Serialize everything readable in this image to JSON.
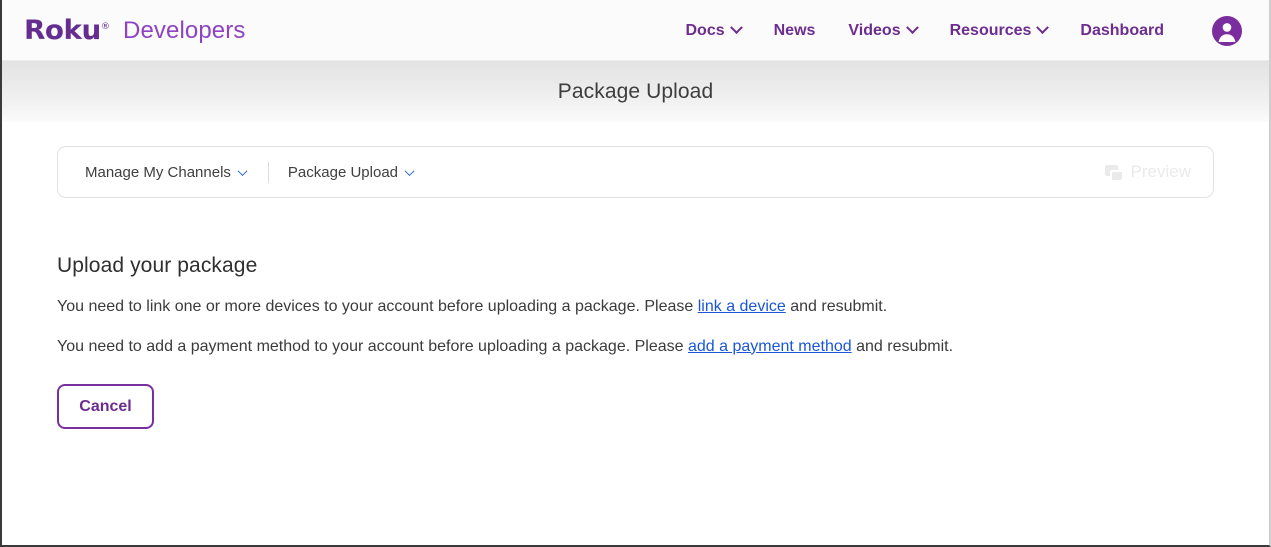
{
  "header": {
    "logo_text": "Roku",
    "logo_trademark": "®",
    "brand_sub": "Developers",
    "nav": [
      {
        "label": "Docs",
        "has_chevron": true,
        "icon": "chevron-down-icon"
      },
      {
        "label": "News",
        "has_chevron": false,
        "icon": ""
      },
      {
        "label": "Videos",
        "has_chevron": true,
        "icon": "chevron-down-icon"
      },
      {
        "label": "Resources",
        "has_chevron": true,
        "icon": "chevron-down-icon"
      },
      {
        "label": "Dashboard",
        "has_chevron": false,
        "icon": ""
      }
    ],
    "account_icon": "user-avatar-icon"
  },
  "title_band": {
    "title": "Package Upload"
  },
  "breadcrumb": {
    "items": [
      {
        "label": "Manage My Channels",
        "icon": "chevron-down-icon"
      },
      {
        "label": "Package Upload",
        "icon": "chevron-down-icon"
      }
    ],
    "preview": {
      "label": "Preview",
      "icon": "windows-copy-icon",
      "disabled": true
    }
  },
  "main": {
    "section_title": "Upload your package",
    "messages": [
      {
        "before": "You need to link one or more devices to your account before uploading a package. Please ",
        "link": "link a device",
        "after": " and resubmit."
      },
      {
        "before": "You need to add a payment method to your account before uploading a package. Please ",
        "link": "add a payment method",
        "after": " and resubmit."
      }
    ],
    "cancel_label": "Cancel"
  },
  "colors": {
    "brand_purple": "#662d91",
    "brand_purple_light": "#8e44c1",
    "nav_purple": "#6d2d8f",
    "link_blue": "#1a56d6",
    "crumb_chevron_blue": "#2f6fe0",
    "disabled_gray": "#eaeaea"
  }
}
